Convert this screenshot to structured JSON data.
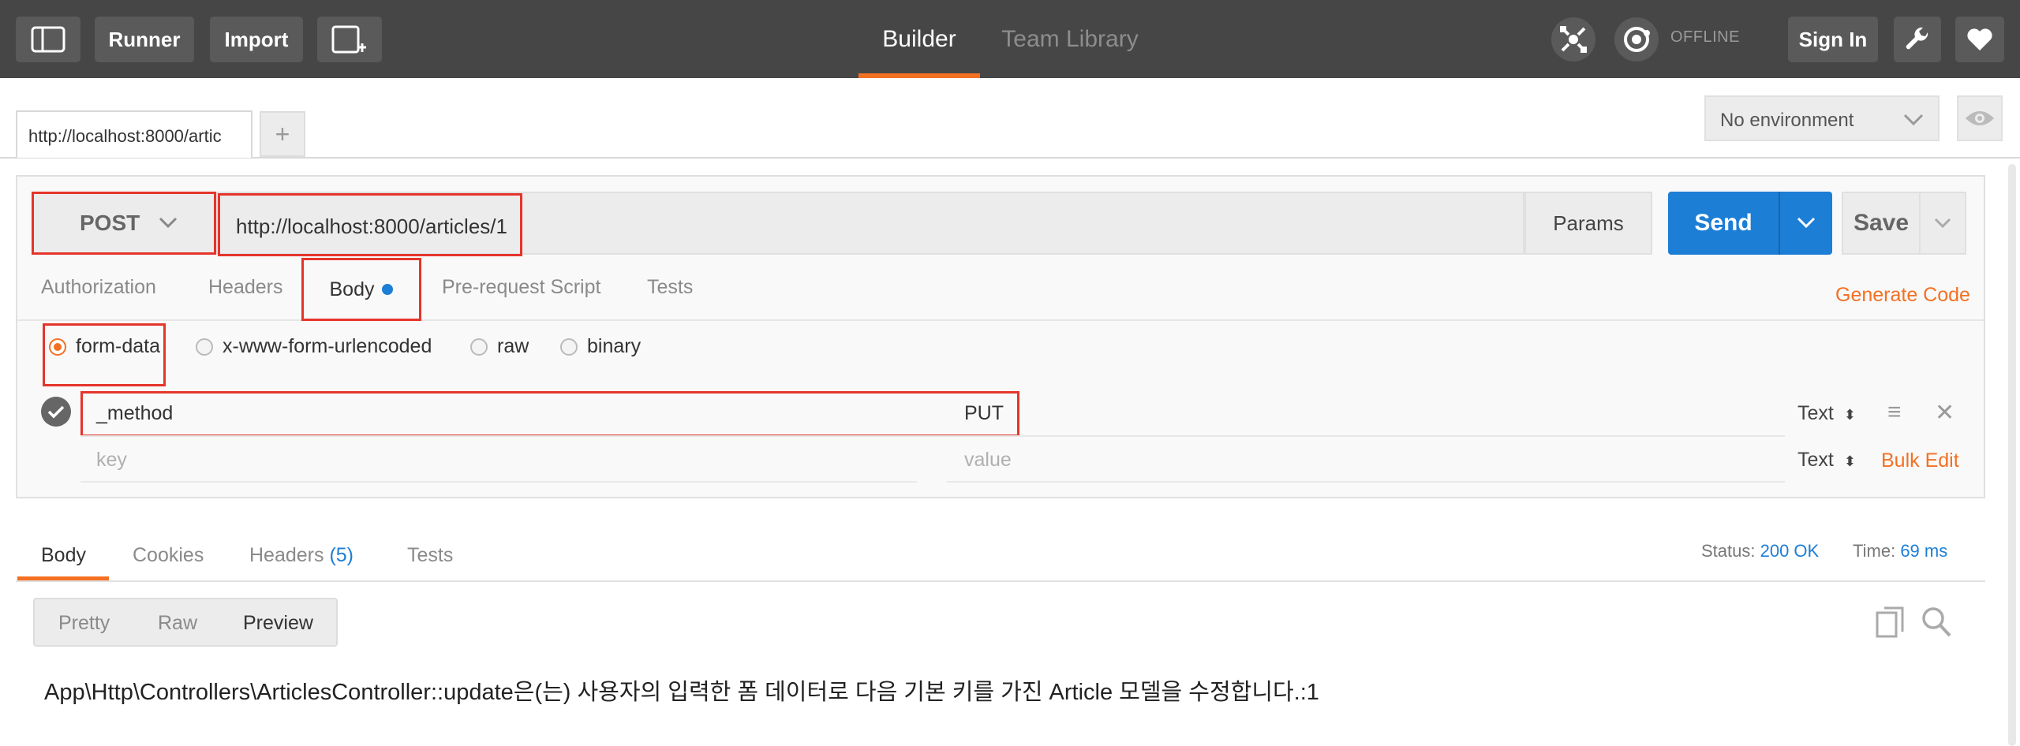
{
  "topbar": {
    "runner_label": "Runner",
    "import_label": "Import",
    "builder_label": "Builder",
    "team_library_label": "Team Library",
    "offline_label": "OFFLINE",
    "sign_in_label": "Sign In"
  },
  "tabs": {
    "active_tab_label": "http://localhost:8000/artic",
    "add_tab_label": "+"
  },
  "environment": {
    "selected": "No environment"
  },
  "request": {
    "method": "POST",
    "url": "http://localhost:8000/articles/1",
    "params_label": "Params",
    "send_label": "Send",
    "save_label": "Save",
    "generate_code_label": "Generate Code",
    "sub_tabs": [
      "Authorization",
      "Headers",
      "Body",
      "Pre-request Script",
      "Tests"
    ],
    "body_modes": [
      "form-data",
      "x-www-form-urlencoded",
      "raw",
      "binary"
    ],
    "selected_body_mode": "form-data",
    "form_rows": [
      {
        "key": "_method",
        "value": "PUT",
        "type": "Text",
        "enabled": true
      }
    ],
    "key_placeholder": "key",
    "value_placeholder": "value",
    "new_row_type": "Text",
    "bulk_edit_label": "Bulk Edit"
  },
  "response": {
    "tabs": [
      "Body",
      "Cookies",
      "Headers",
      "Tests"
    ],
    "headers_count": "(5)",
    "status_label": "Status:",
    "status_value": "200 OK",
    "time_label": "Time:",
    "time_value": "69 ms",
    "view_modes": [
      "Pretty",
      "Raw",
      "Preview"
    ],
    "selected_view": "Preview",
    "body_text": "App\\Http\\Controllers\\ArticlesController::update은(는) 사용자의 입력한 폼 데이터로 다음 기본 키를 가진 Article 모델을 수정합니다.:1"
  },
  "colors": {
    "accent": "#f47023",
    "send_blue": "#1d7ed6",
    "highlight_red": "#e5352b",
    "topbar_bg": "#464646"
  }
}
